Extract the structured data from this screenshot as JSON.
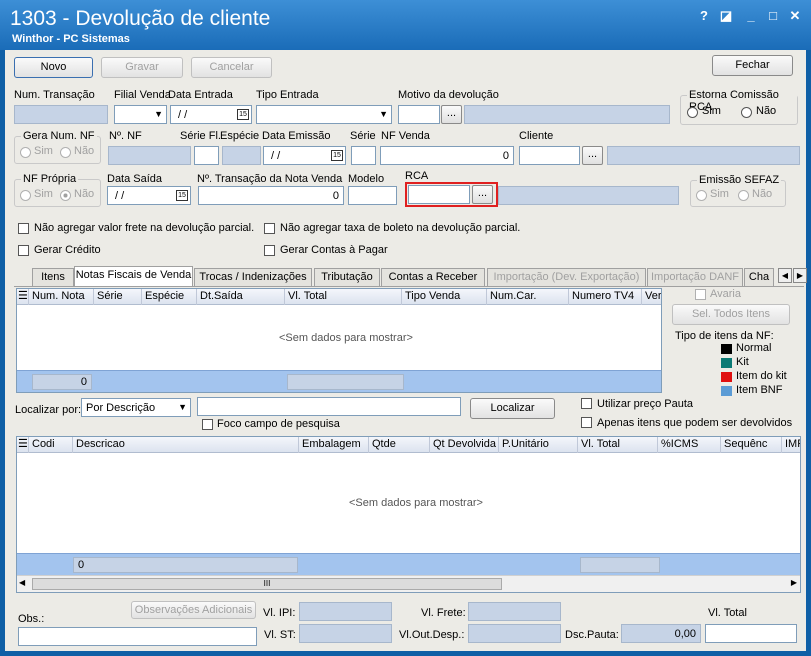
{
  "window": {
    "title": "1303 - Devolução de cliente",
    "subtitle": "Winthor - PC Sistemas",
    "help": "?",
    "minimize": "_",
    "maximize": "□",
    "close": "✕"
  },
  "toolbar": {
    "novo": "Novo",
    "gravar": "Gravar",
    "cancelar": "Cancelar",
    "fechar": "Fechar"
  },
  "labels": {
    "num_transacao": "Num. Transação",
    "filial_venda": "Filial Venda",
    "data_entrada": "Data Entrada",
    "tipo_entrada": "Tipo Entrada",
    "motivo": "Motivo da devolução",
    "estorna": "Estorna Comissão RCA",
    "sim": "Sim",
    "nao": "Não",
    "gera_num_nf": "Gera Num. NF",
    "num_nf": "Nº. NF",
    "serie_fl": "Série Fl.",
    "especie": "Espécie",
    "data_emissao": "Data Emissão",
    "serie": "Série",
    "nf_venda": "NF Venda",
    "cliente": "Cliente",
    "nf_propria": "NF Própria",
    "data_saida": "Data Saída",
    "num_transacao_nota": "Nº. Transação da Nota Venda",
    "modelo": "Modelo",
    "rca": "RCA",
    "emissao_sefaz": "Emissão SEFAZ"
  },
  "values": {
    "date_placeholder": "/ /",
    "nf_venda": "0",
    "num_transacao_nota": "0",
    "calendar_day": "15",
    "dots": "..."
  },
  "checks": {
    "nao_agregar_frete": "Não agregar valor frete na devolução parcial.",
    "nao_agregar_boleto": "Não agregar taxa de boleto na devolução parcial.",
    "gerar_credito": "Gerar Crédito",
    "gerar_contas": "Gerar Contas à Pagar"
  },
  "tabs": [
    "Itens",
    "Notas Fiscais de Venda",
    "Trocas / Indenizações",
    "Tributação",
    "Contas a Receber",
    "Importação (Dev. Exportação)",
    "Importação DANF",
    "Cha"
  ],
  "grid1": {
    "columns": [
      "Num. Nota",
      "Série",
      "Espécie",
      "Dt.Saída",
      "Vl. Total",
      "Tipo Venda",
      "Num.Car.",
      "Numero TV4",
      "Ver"
    ],
    "empty": "<Sem dados para mostrar>",
    "footer_count": "0"
  },
  "side": {
    "avaria": "Avaria",
    "sel_todos": "Sel. Todos Itens",
    "tipo_itens": "Tipo de itens da NF:",
    "legend": [
      {
        "label": "Normal",
        "color": "#000000"
      },
      {
        "label": "Kit",
        "color": "#0b7a75"
      },
      {
        "label": "Item do kit",
        "color": "#e01010"
      },
      {
        "label": "Item BNF",
        "color": "#5b9bd5"
      }
    ]
  },
  "search": {
    "localizar_por": "Localizar por:",
    "selected": "Por Descrição",
    "localizar": "Localizar",
    "foco": "Foco campo de pesquisa",
    "utilizar_preco": "Utilizar preço Pauta",
    "apenas_itens": "Apenas itens que podem ser devolvidos"
  },
  "grid2": {
    "columns": [
      "Codi",
      "Descricao",
      "Embalagem",
      "Qtde",
      "Qt Devolvida",
      "P.Unitário",
      "Vl. Total",
      "%ICMS",
      "Sequênc",
      "IMP"
    ],
    "empty": "<Sem dados para mostrar>",
    "footer_count": "0",
    "hscroll_thumb": "III"
  },
  "bottom": {
    "obs": "Obs.:",
    "observacoes": "Observações Adicionais",
    "vl_ipi": "Vl. IPI:",
    "vl_st": "Vl. ST:",
    "vl_frete": "Vl. Frete:",
    "vl_out_desp": "Vl.Out.Desp.:",
    "vl_total": "Vl. Total",
    "dsc_pauta": "Dsc.Pauta:",
    "dsc_pauta_value": "0,00"
  }
}
